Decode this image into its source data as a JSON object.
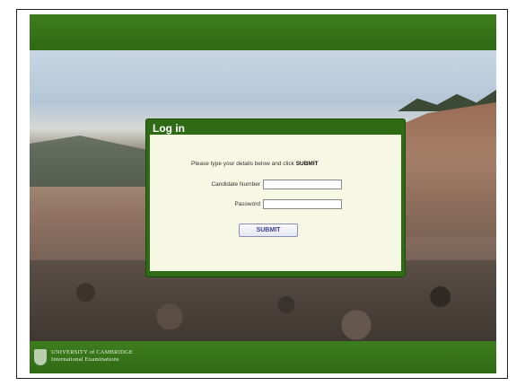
{
  "login": {
    "title": "Log in",
    "instruction_text": "Please type your details below and click ",
    "instruction_emphasis": "SUBMIT",
    "candidate_label": "Candidate Number",
    "candidate_value": "",
    "password_label": "Password",
    "password_value": "",
    "submit_label": "SUBMIT"
  },
  "footer": {
    "org_line1": "UNIVERSITY of CAMBRIDGE",
    "org_line2": "International Examinations"
  },
  "colors": {
    "brand_green": "#2f6a14",
    "panel_bg": "#f7f8e4",
    "button_text": "#3a3f86"
  }
}
